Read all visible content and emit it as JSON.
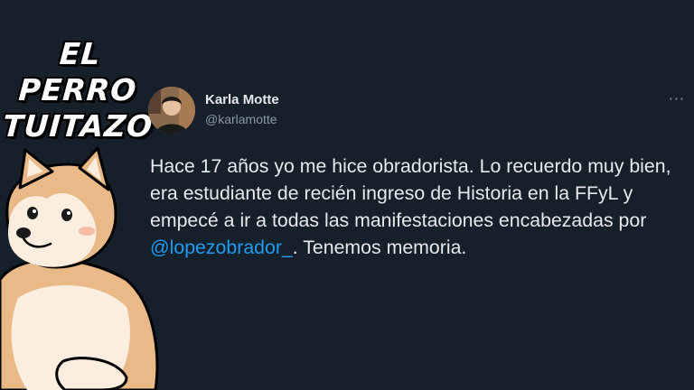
{
  "brand": {
    "line1": "EL PERRO",
    "line2": "TUITAZO"
  },
  "tweet": {
    "author_name": "Karla Motte",
    "author_handle": "@karlamotte",
    "more_label": "···",
    "text_before_mention": "Hace 17 años yo me hice obradorista. Lo recuerdo muy bien, era estudiante de recién ingreso de Historia en la FFyL y empecé a ir a todas las manifestaciones encabezadas por ",
    "mention": "@lopezobrador_",
    "text_after_mention": ". Tenemos memoria."
  },
  "colors": {
    "background": "#15202b",
    "text_primary": "#e7e9ea",
    "text_secondary": "#8b98a5",
    "link": "#1d9bf0"
  },
  "icons": {
    "more": "more-horizontal-icon",
    "avatar": "user-avatar",
    "mascot": "shiba-dog-illustration"
  }
}
